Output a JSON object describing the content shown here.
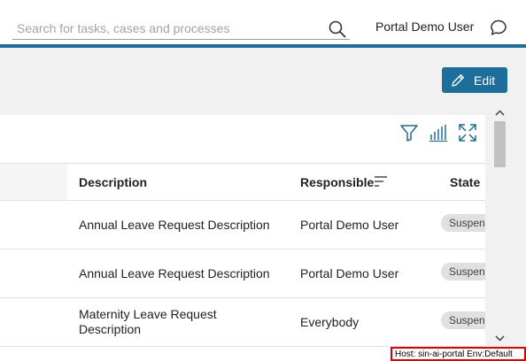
{
  "header": {
    "search": {
      "placeholder": "Search for tasks, cases and processes",
      "value": ""
    },
    "user_name": "Portal Demo User",
    "accent_color": "#1b6f9a"
  },
  "actions": {
    "edit_label": "Edit"
  },
  "toolbar": {
    "icons": [
      "filter-icon",
      "columns-icon",
      "expand-icon"
    ]
  },
  "table": {
    "columns": [
      {
        "label": "Description"
      },
      {
        "label": "Responsible",
        "sort_icon": "sort-icon"
      },
      {
        "label": "State"
      }
    ],
    "rows": [
      {
        "description": "Annual Leave Request Description",
        "responsible": "Portal Demo User",
        "state": "Suspended"
      },
      {
        "description": "Annual Leave Request Description",
        "responsible": "Portal Demo User",
        "state": "Suspended"
      },
      {
        "description": "Maternity Leave Request Description",
        "responsible": "Everybody",
        "state": "Suspended"
      }
    ]
  },
  "footer": {
    "host_info": "Host: sin-ai-portal Env:Default"
  }
}
